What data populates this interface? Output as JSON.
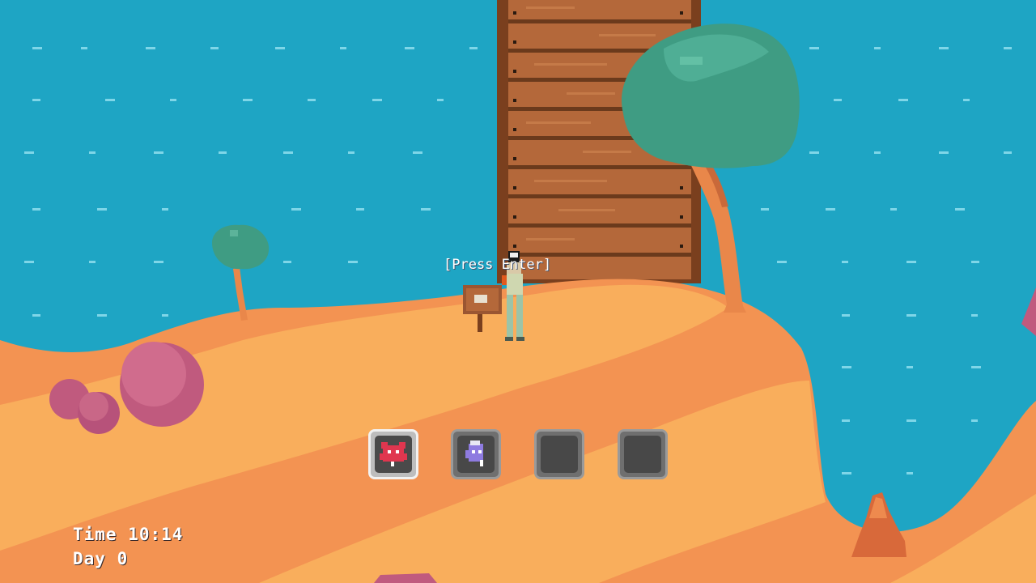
{
  "hud": {
    "time_text": "Time 10:14",
    "day_text": "Day 0"
  },
  "prompt": {
    "text": "[Press Enter]"
  },
  "inventory": {
    "selected_index": 0,
    "slots": [
      {
        "item": "red-creature-icon"
      },
      {
        "item": "purple-creature-icon"
      },
      {
        "item": "empty"
      },
      {
        "item": "empty"
      }
    ]
  },
  "colors": {
    "water": "#1ea5c4",
    "sand_light": "#f9ae5c",
    "sand_dark": "#f39352",
    "tree_foliage": "#3f9c83",
    "bush": "#c05a7e",
    "wood": "#b4683a"
  }
}
